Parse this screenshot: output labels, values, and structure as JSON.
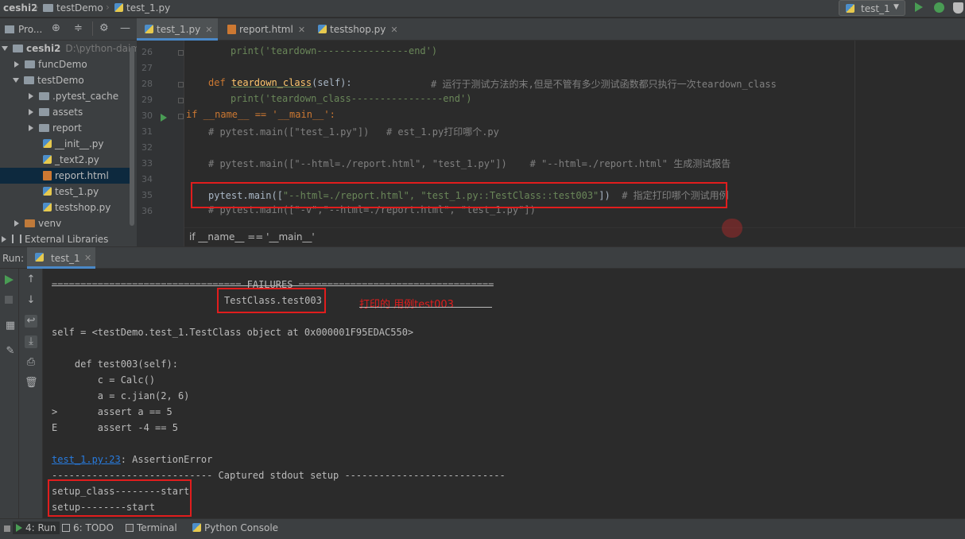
{
  "breadcrumb": [
    "ceshi2",
    "testDemo",
    "test_1.py"
  ],
  "run_config": {
    "label": "test_1"
  },
  "project_panel": {
    "title": "Pro..."
  },
  "project_tree": [
    {
      "label": "ceshi2",
      "hint": "D:\\python-daim",
      "kind": "folder",
      "expanded": true
    },
    {
      "label": "funcDemo",
      "kind": "folder",
      "expanded": false
    },
    {
      "label": "testDemo",
      "kind": "folder",
      "expanded": true
    },
    {
      "label": ".pytest_cache",
      "kind": "folder",
      "expanded": false
    },
    {
      "label": "assets",
      "kind": "folder",
      "expanded": false
    },
    {
      "label": "report",
      "kind": "folder",
      "expanded": false
    },
    {
      "label": "__init__.py",
      "kind": "python"
    },
    {
      "label": "_text2.py",
      "kind": "python"
    },
    {
      "label": "report.html",
      "kind": "html",
      "selected": true
    },
    {
      "label": "test_1.py",
      "kind": "python"
    },
    {
      "label": "testshop.py",
      "kind": "python"
    },
    {
      "label": "venv",
      "kind": "folder",
      "expanded": false
    },
    {
      "label": "External Libraries",
      "kind": "library",
      "expanded": false
    }
  ],
  "editor_tabs": [
    {
      "label": "test_1.py",
      "active": true
    },
    {
      "label": "report.html",
      "active": false
    },
    {
      "label": "testshop.py",
      "active": false
    }
  ],
  "editor": {
    "line_numbers": [
      "26",
      "27",
      "28",
      "29",
      "30",
      "31",
      "32",
      "33",
      "34",
      "35",
      "36"
    ],
    "lines": {
      "l26": "print('teardown----------------end')",
      "l28_def": "def ",
      "l28_fn": "teardown_class",
      "l28_args": "(self):",
      "l28_comment": "# 运行于测试方法的末,但是不管有多少测试函数都只执行一次teardown_class",
      "l29": "print('teardown_class----------------end')",
      "l30": "if __name__ == '__main__':",
      "l31": "# pytest.main([\"test_1.py\"])   # est_1.py打印哪个.py",
      "l33": "# pytest.main([\"--html=./report.html\", \"test_1.py\"])    # \"--html=./report.html\" 生成测试报告",
      "l35_call": "pytest.main([",
      "l35_args": "\"--html=./report.html\", \"test_1.py::TestClass::test003\"",
      "l35_close": "])",
      "l35_comment": "# 指定打印哪个测试用例",
      "l36": "# pytest.main([\"-v\",\"--html=./report.html\", \"test_1.py\"])"
    },
    "breadcrumb": "if __name__ == '__main__'"
  },
  "run_panel": {
    "label": "Run:",
    "tab": "test_1"
  },
  "console": {
    "failures_header": "================================= FAILURES ==================================",
    "test_header": "TestClass.test003",
    "annotation": "打印的 用例test003",
    "lines": [
      "self = <testDemo.test_1.TestClass object at 0x000001F95EDAC550>",
      "    def test003(self):",
      "        c = Calc()",
      "        a = c.jian(2, 6)",
      ">       assert a == 5",
      "E       assert -4 == 5"
    ],
    "error_link": "test_1.py:23",
    "error_text": ": AssertionError",
    "captured_header": "---------------------------- Captured stdout setup ----------------------------",
    "stdout": [
      "setup_class--------start",
      "setup--------start"
    ]
  },
  "bottom_tabs": [
    {
      "label": "4: Run",
      "active": true
    },
    {
      "label": "6: TODO",
      "active": false
    },
    {
      "label": "Terminal",
      "active": false
    },
    {
      "label": "Python Console",
      "active": false
    }
  ],
  "colors": {
    "keyword": "#cc7832",
    "string": "#6a8759",
    "comment": "#808080",
    "function": "#ffc66d",
    "highlight_box": "#e11d1d",
    "link": "#287bde"
  }
}
